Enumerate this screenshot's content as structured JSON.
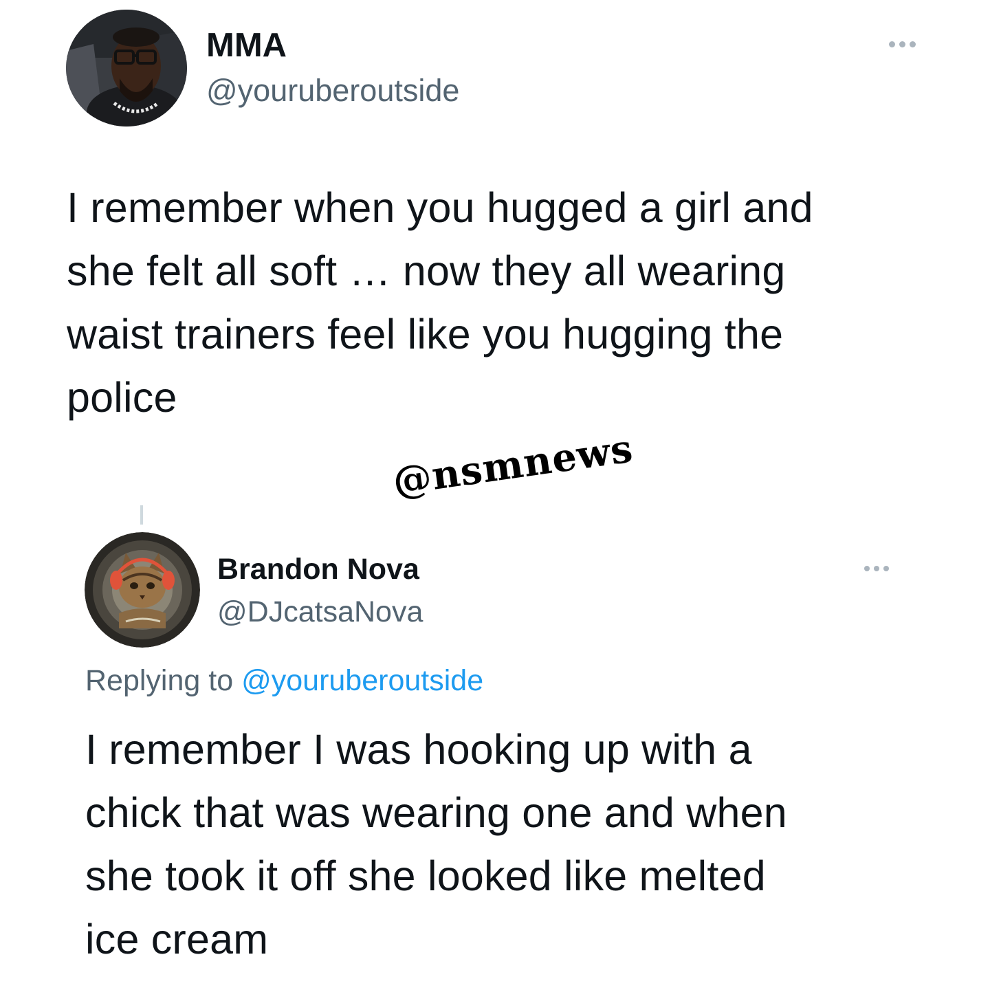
{
  "original_tweet": {
    "display_name": "MMA",
    "handle": "@youruberoutside",
    "text_lines": [
      "I remember when you hugged a girl and",
      "she felt all soft … now they all wearing",
      "waist trainers feel like you hugging the",
      "police"
    ],
    "more_icon": "more-horizontal-icon",
    "avatar_icon": "profile-photo-icon"
  },
  "watermark": "@nsmnews",
  "reply_tweet": {
    "display_name": "Brandon Nova",
    "handle": "@DJcatsaNova",
    "replying_to_prefix": "Replying to",
    "replying_to_handle": "@youruberoutside",
    "text_lines": [
      "I remember I was hooking up with a",
      "chick that was wearing one and when",
      "she took it off she looked like melted",
      "ice cream"
    ],
    "more_icon": "more-horizontal-icon",
    "avatar_icon": "cat-avatar-icon"
  },
  "colors": {
    "text": "#0f1419",
    "secondary": "#536471",
    "link": "#1d9bf0",
    "divider": "#cfd9de"
  }
}
